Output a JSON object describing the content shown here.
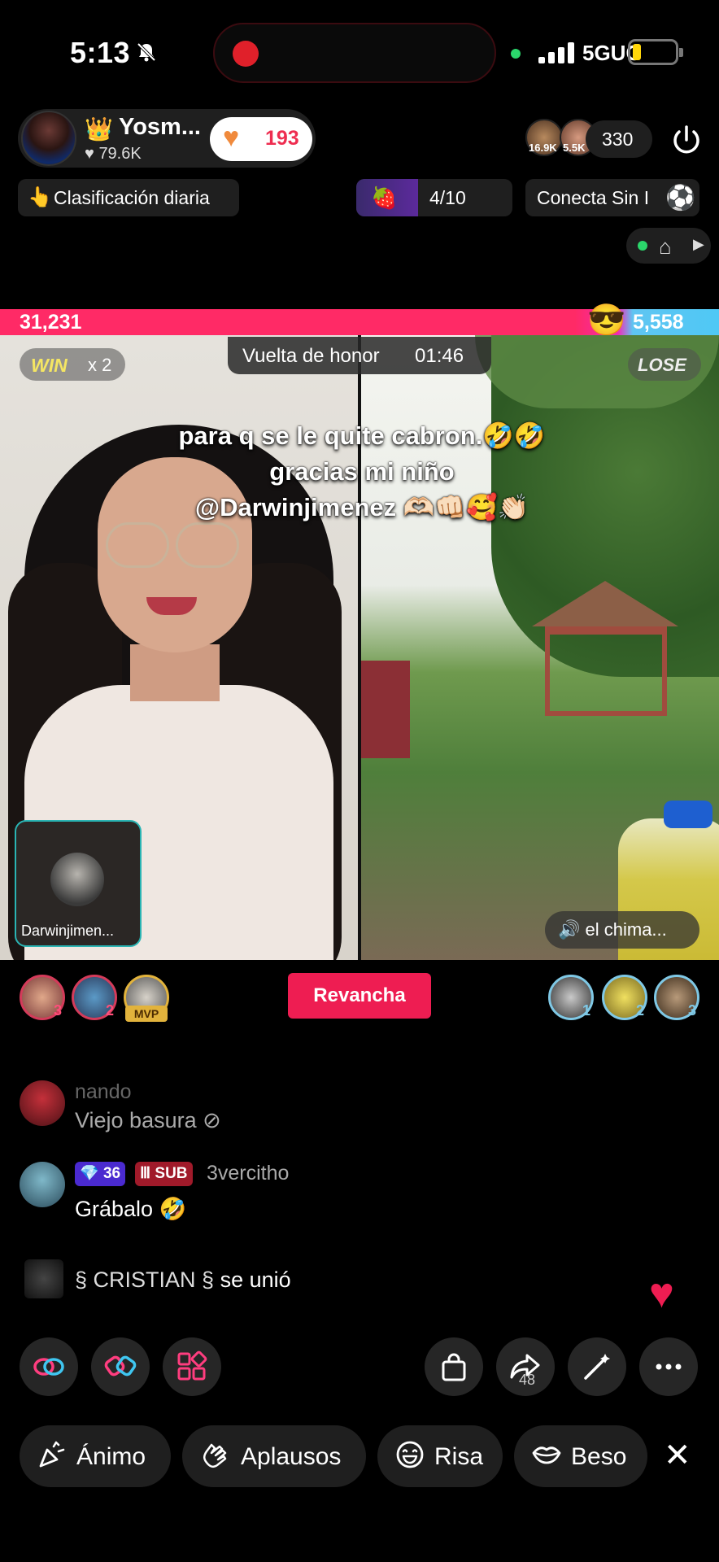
{
  "status": {
    "time": "5:13",
    "network": "5GUC"
  },
  "host": {
    "name": "Yosm...",
    "likes": "79.6K",
    "follow_count": "193"
  },
  "viewers": {
    "badges": [
      "16.9K",
      "5.5K"
    ],
    "count": "330"
  },
  "header_row": {
    "ranking_label": "Clasificación diaria",
    "task_progress": "4/10",
    "connect_label": "Conecta Sin I"
  },
  "battle": {
    "left_score": "31,231",
    "right_score": "5,558",
    "win_label": "WIN",
    "win_multiplier": "x 2",
    "lose_label": "LOSE",
    "phase_label": "Vuelta de honor",
    "timer": "01:46",
    "overlay_lines": [
      "para q se le quite cabron.🤣🤣",
      "gracias mi niño",
      "@Darwinjimenez   🫶🏻👊🏻🥰👏🏻"
    ],
    "guest_name": "Darwinjimen...",
    "audio_label": "el chima...",
    "rematch_label": "Revancha",
    "left_ranks": [
      "3",
      "2"
    ],
    "mvp_label": "MVP",
    "right_ranks": [
      "1",
      "2",
      "3"
    ]
  },
  "chat": [
    {
      "user": "nando",
      "message": "Viejo basura"
    },
    {
      "user": "3vercitho",
      "level": "36",
      "badge": "SUB",
      "message": "Grábalo 🤣"
    },
    {
      "user": "§ CRISTIAN §",
      "message": "se unió"
    }
  ],
  "actions": {
    "share_count": "48"
  },
  "reactions": [
    {
      "label": "Ánimo"
    },
    {
      "label": "Aplausos"
    },
    {
      "label": "Risa"
    },
    {
      "label": "Beso"
    }
  ],
  "colors": {
    "accent": "#ee1d52",
    "score_left": "#ff2a66",
    "score_right": "#4fc8f5",
    "win_gold": "#f5e663"
  }
}
